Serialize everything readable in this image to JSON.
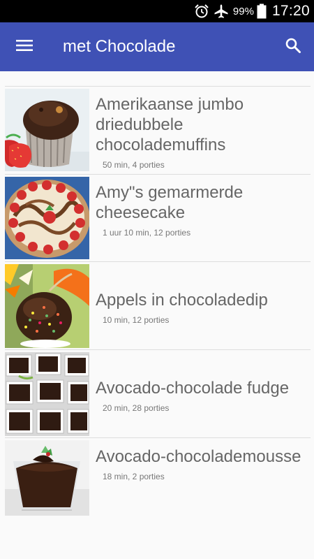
{
  "status_bar": {
    "icons": [
      "alarm-icon",
      "airplane-mode-icon",
      "battery-icon"
    ],
    "battery_percent": "99%",
    "time": "17:20"
  },
  "app_bar": {
    "title": "met Chocolade",
    "menu_icon": "hamburger-menu-icon",
    "search_icon": "search-icon",
    "color": "#3f51b5"
  },
  "recipes": [
    {
      "title": "Amerikaanse jumbo driedubbele chocolademuffins",
      "meta": "50 min, 4 porties",
      "image": "chocolate-muffin-photo"
    },
    {
      "title": "Amy\"s gemarmerde cheesecake",
      "meta": "1 uur 10 min, 12 porties",
      "image": "marbled-cheesecake-photo"
    },
    {
      "title": "Appels in chocoladedip",
      "meta": "10 min, 12 porties",
      "image": "chocolate-dipped-apple-photo"
    },
    {
      "title": "Avocado-chocolade fudge",
      "meta": "20 min, 28 porties",
      "image": "chocolate-fudge-photo"
    },
    {
      "title": "Avocado-chocolademousse",
      "meta": "18 min, 2 porties",
      "image": "chocolate-mousse-photo"
    }
  ]
}
